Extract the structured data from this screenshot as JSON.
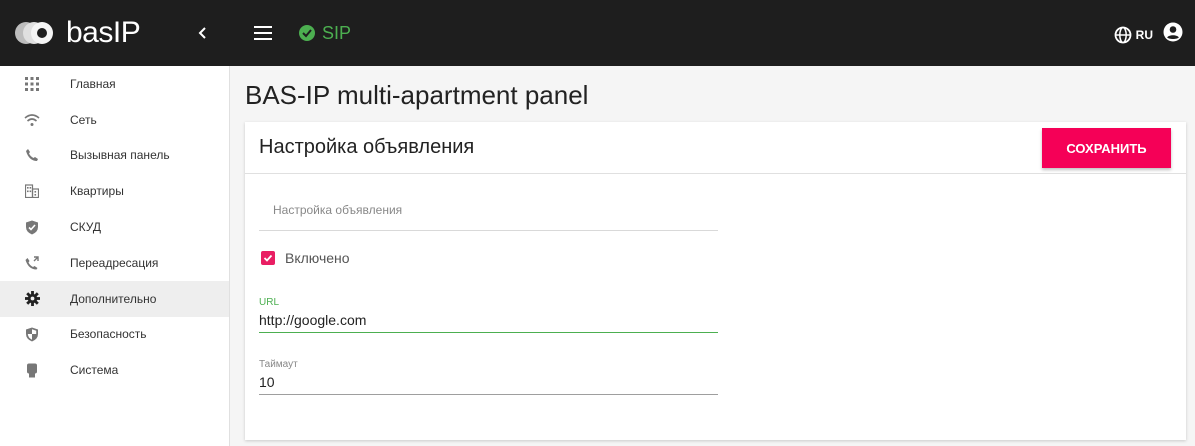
{
  "brand": {
    "name": "basIP"
  },
  "status": {
    "sip_label": "SIP",
    "sip_color": "#4caf50"
  },
  "header": {
    "language": "RU"
  },
  "sidebar": {
    "items": [
      {
        "label": "Главная",
        "icon": "grid-icon"
      },
      {
        "label": "Сеть",
        "icon": "wifi-icon"
      },
      {
        "label": "Вызывная панель",
        "icon": "phone-icon"
      },
      {
        "label": "Квартиры",
        "icon": "building-icon"
      },
      {
        "label": "СКУД",
        "icon": "shield-check-icon"
      },
      {
        "label": "Переадресация",
        "icon": "phone-forward-icon"
      },
      {
        "label": "Дополнительно",
        "icon": "gear-icon",
        "active": true
      },
      {
        "label": "Безопасность",
        "icon": "security-shield-icon"
      },
      {
        "label": "Система",
        "icon": "device-icon"
      }
    ]
  },
  "main": {
    "title": "BAS-IP multi-apartment panel",
    "card": {
      "title": "Настройка объявления",
      "save_label": "СОХРАНИТЬ",
      "placeholder_field": "Настройка объявления",
      "enabled_label": "Включено",
      "enabled_checked": true,
      "url_label": "URL",
      "url_value": "http://google.com",
      "timeout_label": "Таймаут",
      "timeout_value": "10"
    }
  },
  "colors": {
    "accent": "#f50057",
    "topbar": "#1e1e1e",
    "success": "#4caf50"
  }
}
